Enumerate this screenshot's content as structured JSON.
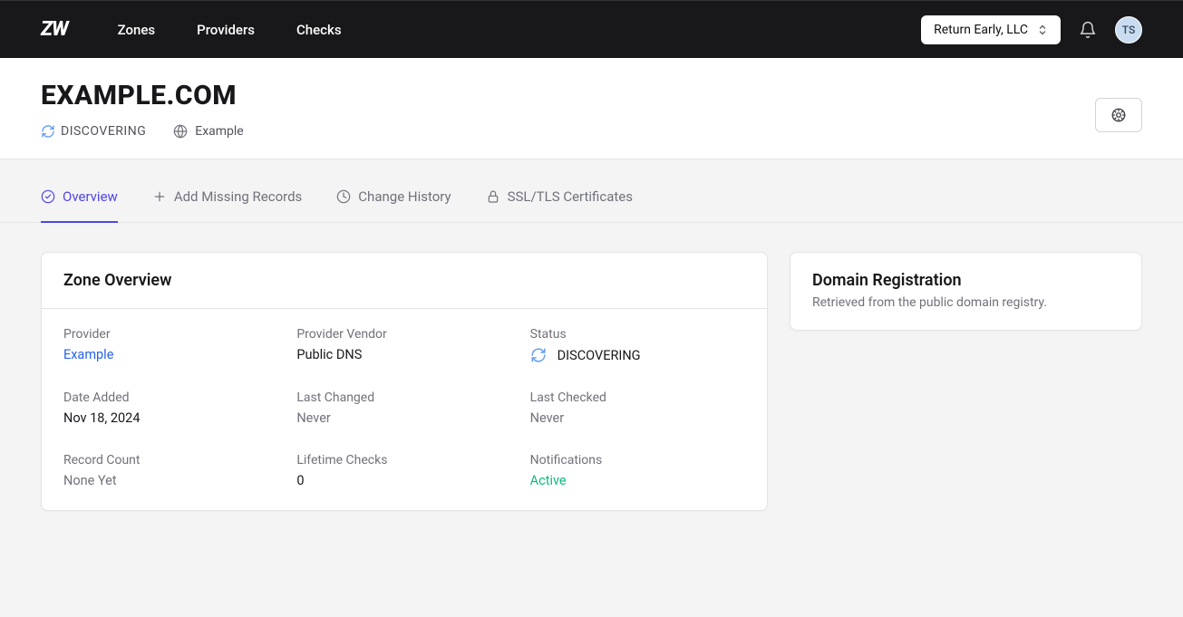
{
  "logo": "ZW",
  "nav": {
    "zones": "Zones",
    "providers": "Providers",
    "checks": "Checks"
  },
  "org": {
    "name": "Return Early, LLC"
  },
  "avatar_initials": "TS",
  "header": {
    "title": "EXAMPLE.COM",
    "status": "DISCOVERING",
    "provider": "Example"
  },
  "tabs": {
    "overview": "Overview",
    "add": "Add Missing Records",
    "history": "Change History",
    "ssl": "SSL/TLS Certificates"
  },
  "zone": {
    "card_title": "Zone Overview",
    "provider_label": "Provider",
    "provider_value": "Example",
    "vendor_label": "Provider Vendor",
    "vendor_value": "Public DNS",
    "status_label": "Status",
    "status_value": "DISCOVERING",
    "date_added_label": "Date Added",
    "date_added_value": "Nov 18, 2024",
    "last_changed_label": "Last Changed",
    "last_changed_value": "Never",
    "last_checked_label": "Last Checked",
    "last_checked_value": "Never",
    "record_count_label": "Record Count",
    "record_count_value": "None Yet",
    "lifetime_checks_label": "Lifetime Checks",
    "lifetime_checks_value": "0",
    "notifications_label": "Notifications",
    "notifications_value": "Active"
  },
  "registration": {
    "title": "Domain Registration",
    "subtitle": "Retrieved from the public domain registry."
  }
}
